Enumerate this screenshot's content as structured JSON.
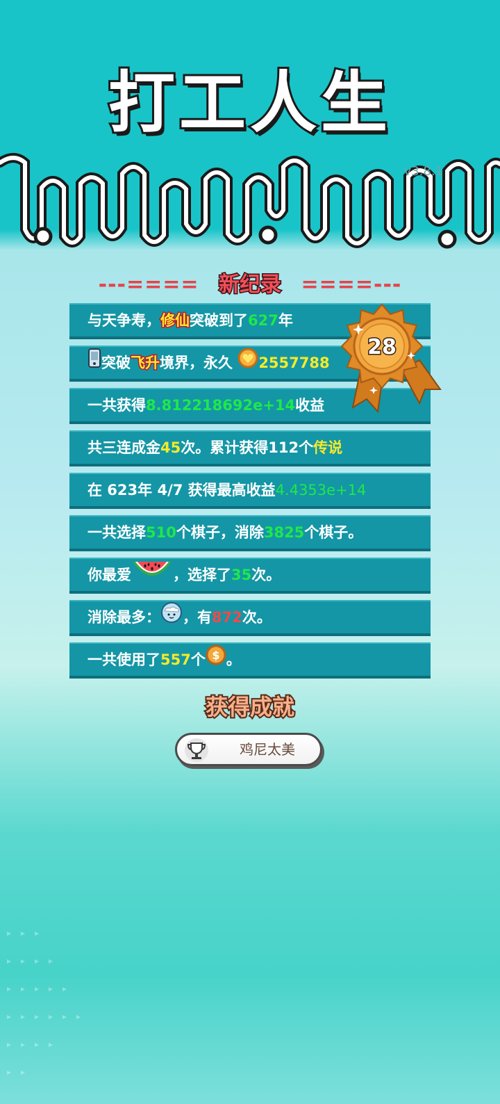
{
  "game": {
    "title": "打工人生",
    "version": "v3.8.1"
  },
  "record": {
    "dash_left": "---====",
    "heading": "新纪录",
    "dash_right": "====---",
    "medal_number": "28"
  },
  "rows": {
    "r1": {
      "a": "与天争寿，",
      "b": "修仙",
      "c": "突破到了",
      "d": "627",
      "e": "年"
    },
    "r2": {
      "a": "突破",
      "b": "飞升",
      "c": "境界，永久",
      "d": "2557788"
    },
    "r3": {
      "a": "一共获得",
      "b": "8.812218692e+14",
      "c": "收益"
    },
    "r4": {
      "a": "共",
      "b": "三连成金",
      "c": "45",
      "d": "次。累计获得",
      "e": "112",
      "f": "个",
      "g": "传说"
    },
    "r5": {
      "a": "在 623年 4/7 获得最高收益",
      "b": "4.4353e+14"
    },
    "r6": {
      "a": "一共选择",
      "b": "510",
      "c": "个棋子，消除",
      "d": "3825",
      "e": "个棋子。"
    },
    "r7": {
      "a": "你最爱",
      "b": "，选择了",
      "c": "35",
      "d": "次。"
    },
    "r8": {
      "a": "消除最多：",
      "b": "，有",
      "c": "872",
      "d": "次。"
    },
    "r9": {
      "a": "一共使用了",
      "b": "557",
      "c": "个",
      "d": "。"
    }
  },
  "achievement": {
    "heading": "获得成就",
    "badge_label": "鸡尼太美"
  },
  "icons": {
    "phone": "phone-icon",
    "heart_coin": "heart-coin-icon",
    "watermelon": "watermelon-icon",
    "cloud_face": "cloud-face-icon",
    "coin": "dollar-coin-icon",
    "trophy": "trophy-icon",
    "medal": "medal-icon"
  },
  "colors": {
    "header_bg": "#18c4c8",
    "row_bg": "#1496a6",
    "green_value": "#1ee84a",
    "yellow_value": "#f4ea2a",
    "red_value": "#ee4a4a",
    "record_red": "#f0505a",
    "medal_orange": "#d27a1e"
  }
}
